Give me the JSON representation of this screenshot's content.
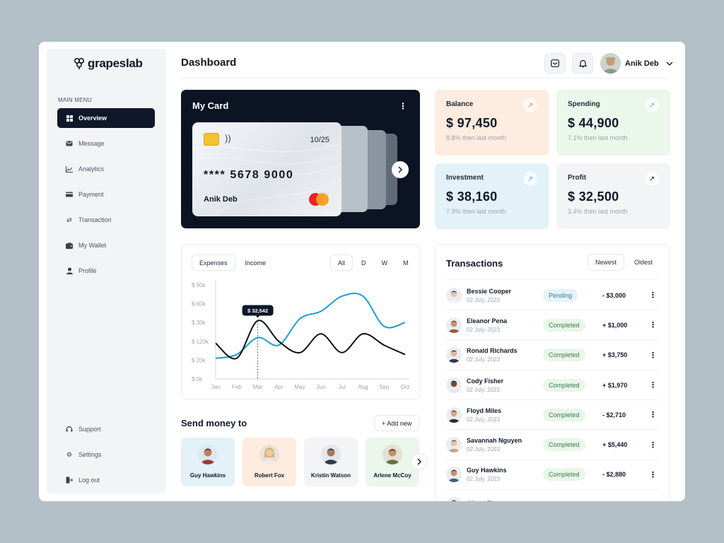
{
  "sidebar": {
    "brand": "grapeslab",
    "menu_title": "MAIN MENU",
    "items": [
      {
        "label": "Overview",
        "icon": "grid-icon"
      },
      {
        "label": "Message",
        "icon": "mail-icon"
      },
      {
        "label": "Analytics",
        "icon": "chart-icon"
      },
      {
        "label": "Payment",
        "icon": "credit-card-icon"
      },
      {
        "label": "Transaction",
        "icon": "swap-icon"
      },
      {
        "label": "My Wallet",
        "icon": "wallet-icon"
      },
      {
        "label": "Profile",
        "icon": "user-icon"
      }
    ],
    "bottom": [
      {
        "label": "Support",
        "icon": "headset-icon"
      },
      {
        "label": "Settings",
        "icon": "gear-icon"
      },
      {
        "label": "Log out",
        "icon": "logout-icon"
      }
    ]
  },
  "header": {
    "title": "Dashboard",
    "user_name": "Anik Deb"
  },
  "my_card": {
    "title": "My Card",
    "expiry": "10/25",
    "number": "**** 5678 9000",
    "holder": "Anik Deb"
  },
  "stats": [
    {
      "label": "Balance",
      "value": "$ 97,450",
      "sub": "8.8% then last month",
      "bg": "#fdecdf"
    },
    {
      "label": "Spending",
      "value": "$ 44,900",
      "sub": "7.1% then last month",
      "bg": "#eaf7ea"
    },
    {
      "label": "Investment",
      "value": "$ 38,160",
      "sub": "7.9% then last month",
      "bg": "#e3f1f8"
    },
    {
      "label": "Profit",
      "value": "$ 32,500",
      "sub": "3.4% then last month",
      "bg": "#f3f4f6"
    }
  ],
  "chart_tabs": {
    "expenses": "Expenses",
    "income": "Income",
    "all": "All",
    "d": "D",
    "w": "W",
    "m": "M"
  },
  "chart_data": {
    "type": "line",
    "categories": [
      "Jan",
      "Feb",
      "Mar",
      "Apr",
      "May",
      "Jun",
      "Jul",
      "Aug",
      "Sep",
      "Oct"
    ],
    "y_ticks": [
      "$ 0k",
      "$ 20k",
      "$ 120k",
      "$ 30k",
      "$ 60k",
      "$ 90k"
    ],
    "tooltip": "$ 32,542",
    "highlight_index": 2,
    "series": [
      {
        "color": "#1a9fd1",
        "values": [
          1.1,
          1.3,
          2.2,
          1.8,
          3.2,
          3.6,
          4.4,
          4.4,
          2.8,
          3.0
        ]
      },
      {
        "color": "#111111",
        "values": [
          1.9,
          1.1,
          3.1,
          2.0,
          1.4,
          2.4,
          1.4,
          2.4,
          1.8,
          1.3
        ]
      }
    ]
  },
  "send_money": {
    "title": "Send money to",
    "add_label": "+ Add new",
    "contacts": [
      {
        "name": "Guy Hawkins",
        "bg": "#e3f1f8"
      },
      {
        "name": "Robert Fox",
        "bg": "#fdecdf"
      },
      {
        "name": "Kristin Watson",
        "bg": "#f3f4f6"
      },
      {
        "name": "Arlene McCoy",
        "bg": "#eaf7ea"
      }
    ]
  },
  "transactions": {
    "title": "Transactions",
    "newest": "Newest",
    "oldest": "Oldest",
    "rows": [
      {
        "name": "Bessie Cooper",
        "date": "02 July, 2023",
        "status": "Pending",
        "amount": "- $3,000"
      },
      {
        "name": "Eleanor Pena",
        "date": "02 July, 2023",
        "status": "Completed",
        "amount": "+ $1,000"
      },
      {
        "name": "Ronald Richards",
        "date": "02 July, 2023",
        "status": "Completed",
        "amount": "+ $3,750"
      },
      {
        "name": "Cody Fisher",
        "date": "02 July, 2023",
        "status": "Completed",
        "amount": "+ $1,970"
      },
      {
        "name": "Floyd Miles",
        "date": "02 July, 2023",
        "status": "Completed",
        "amount": "- $2,710"
      },
      {
        "name": "Savannah Nguyen",
        "date": "02 July, 2023",
        "status": "Completed",
        "amount": "+ $5,440"
      },
      {
        "name": "Guy Hawkins",
        "date": "02 July, 2023",
        "status": "Completed",
        "amount": "- $2,880"
      },
      {
        "name": "Albert Flores",
        "date": "",
        "status": "",
        "amount": ""
      }
    ]
  }
}
